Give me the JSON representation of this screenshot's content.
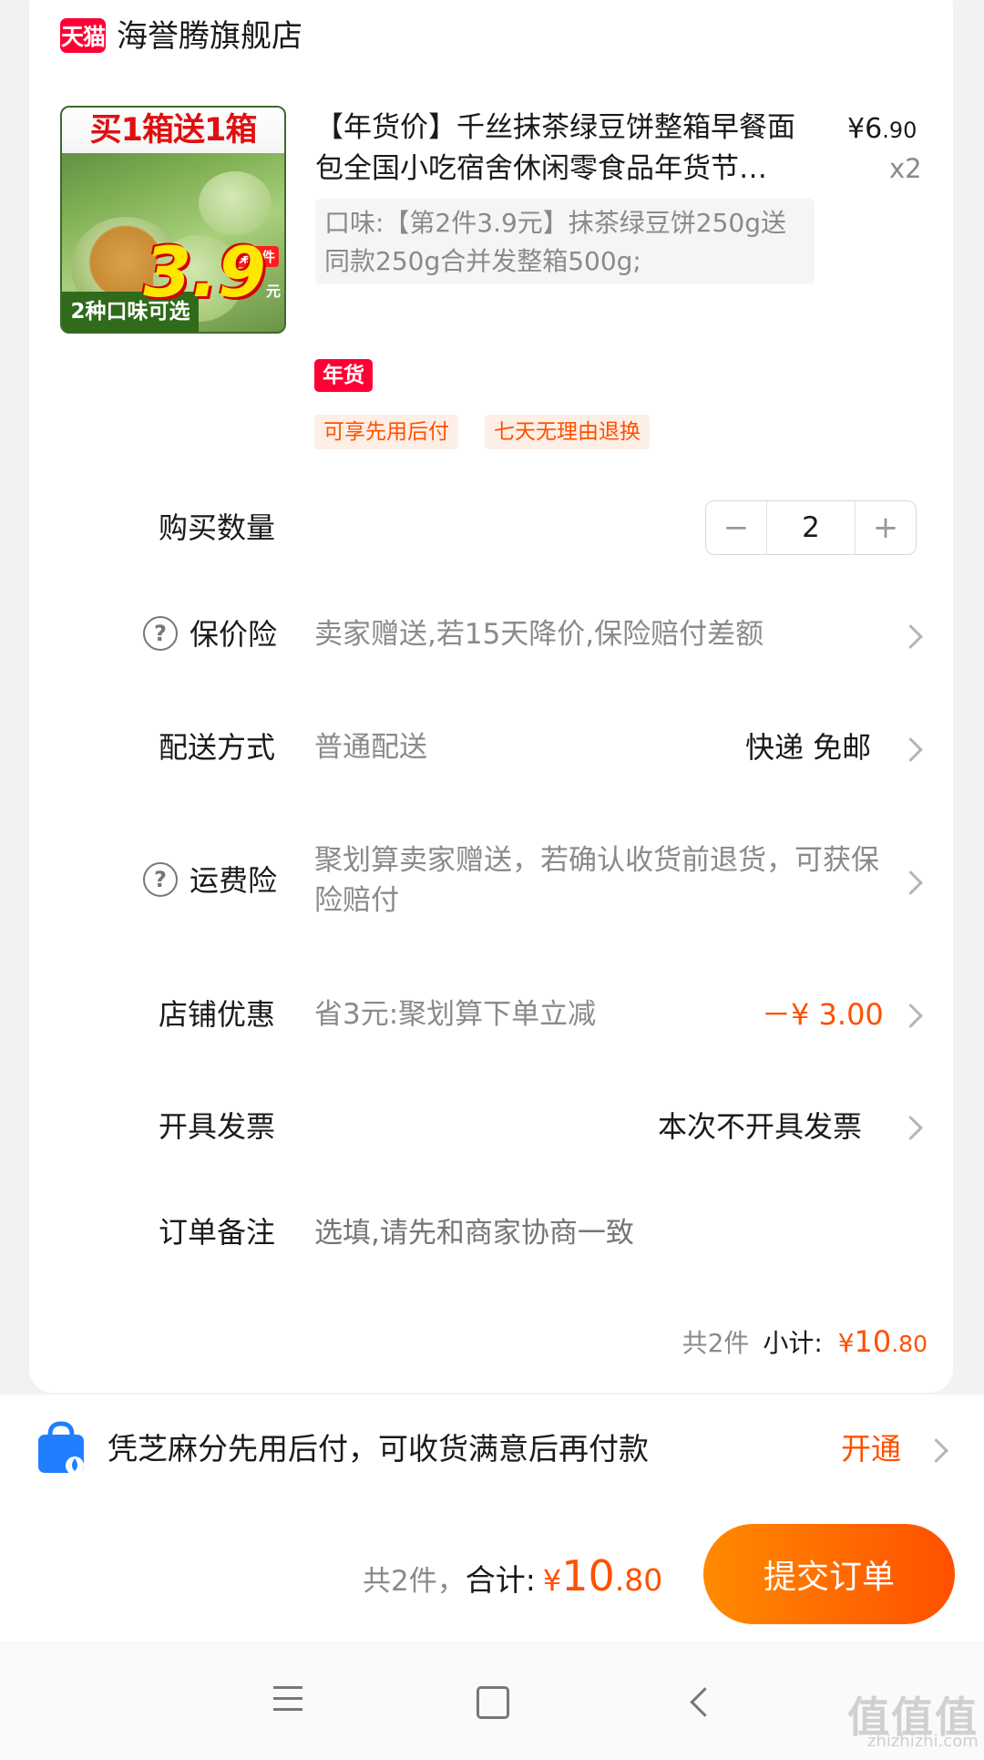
{
  "store": {
    "logo_text": "天猫",
    "name": "海誉腾旗舰店"
  },
  "product": {
    "image": {
      "banner": "买1箱送1箱",
      "bottom_text": "2种口味可选",
      "tag": "第2件",
      "price": "3.9",
      "price_unit": "元"
    },
    "title": "【年货价】千丝抹茶绿豆饼整箱早餐面包全国小吃宿舍休闲零食品年货节…",
    "price_currency": "¥",
    "price_int": "6",
    "price_dec": ".90",
    "quantity": "x2",
    "sku": "口味:【第2件3.9元】抹茶绿豆饼250g送同款250g合并发整箱500g;",
    "badge": "年货",
    "services": [
      "可享先用后付",
      "七天无理由退换"
    ]
  },
  "rows": {
    "quantity": {
      "label": "购买数量",
      "minus": "−",
      "value": "2",
      "plus": "+"
    },
    "price_protection": {
      "label": "保价险",
      "desc": "卖家赠送,若15天降价,保险赔付差额"
    },
    "delivery": {
      "label": "配送方式",
      "desc": "普通配送",
      "value": "快递 免邮"
    },
    "shipping_insurance": {
      "label": "运费险",
      "desc": "聚划算卖家赠送，若确认收货前退货，可获保险赔付"
    },
    "discount": {
      "label": "店铺优惠",
      "desc": "省3元:聚划算下单立减",
      "value": "－¥ 3.00"
    },
    "invoice": {
      "label": "开具发票",
      "value": "本次不开具发票"
    },
    "note": {
      "label": "订单备注",
      "placeholder": "选填,请先和商家协商一致"
    }
  },
  "subtotal": {
    "count": "共2件",
    "label": "小计:",
    "currency": "¥",
    "int": "10",
    "dec": ".80"
  },
  "pay_later": {
    "text": "凭芝麻分先用后付，可收货满意后再付款",
    "action": "开通"
  },
  "footer": {
    "count": "共2件，",
    "label": "合计:",
    "currency": "¥",
    "int": "10",
    "dec": ".80",
    "submit": "提交订单"
  },
  "watermark": {
    "text": "值值值",
    "url": "zhizhizhi.com"
  },
  "colors": {
    "accent": "#ff5000",
    "tmall_red": "#ff0036"
  }
}
